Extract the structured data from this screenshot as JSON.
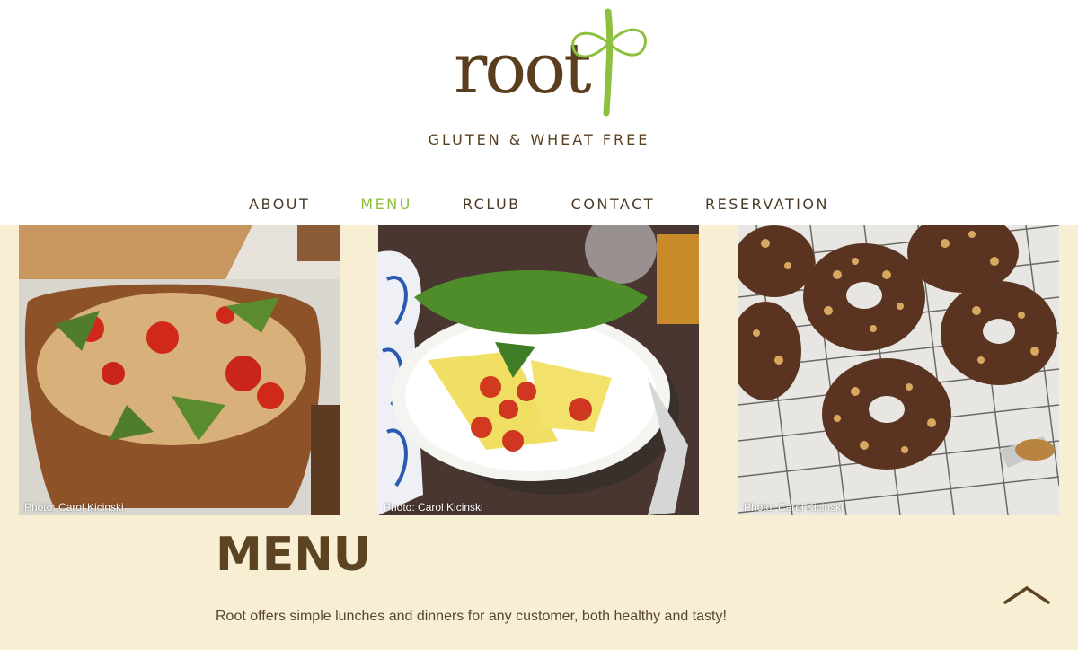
{
  "brand": {
    "logo_text": "root",
    "tagline": "GLUTEN & WHEAT FREE"
  },
  "nav": {
    "items": [
      {
        "label": "ABOUT"
      },
      {
        "label": "MENU",
        "active": true
      },
      {
        "label": "RCLUB"
      },
      {
        "label": "CONTACT"
      },
      {
        "label": "RESERVATION"
      }
    ]
  },
  "gallery": {
    "photos": [
      {
        "subject": "pasta salad",
        "credit": "Photo: Carol Kicinski"
      },
      {
        "subject": "crepes with tomatoes and greens",
        "credit": "Photo: Carol Kicinski"
      },
      {
        "subject": "glazed donuts with nuts",
        "credit": "Photo: Carol Kicinski"
      }
    ]
  },
  "main": {
    "title": "MENU",
    "intro": "Root offers simple lunches and dinners for any customer, both healthy and tasty!"
  },
  "colors": {
    "background": "#f8eed4",
    "header": "#ffffff",
    "accent_green": "#8dc03c",
    "brown": "#5c4322"
  },
  "icons": {
    "scroll_top": "chevron-up-icon"
  }
}
